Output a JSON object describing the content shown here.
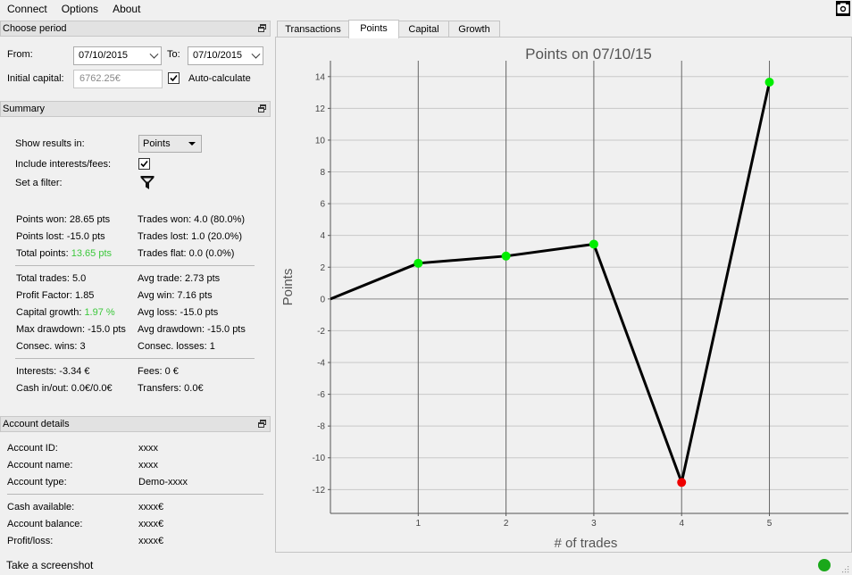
{
  "menu": [
    "Connect",
    "Options",
    "About"
  ],
  "icons": {
    "screenshot": "camera-icon",
    "float": "float-window-icon",
    "filter": "filter-funnel-icon",
    "status": "status-ok-dot"
  },
  "period": {
    "title": "Choose period",
    "from_label": "From:",
    "from_value": "07/10/2015",
    "to_label": "To:",
    "to_value": "07/10/2015",
    "capital_label": "Initial capital:",
    "capital_value": "6762.25€",
    "autocalc_label": "Auto-calculate",
    "autocalc_checked": true
  },
  "summary": {
    "title": "Summary",
    "show_label": "Show results in:",
    "show_value": "Points",
    "interests_label": "Include interests/fees:",
    "interests_checked": true,
    "filter_label": "Set a filter:",
    "stats": {
      "points_won": "Points won: 28.65 pts",
      "trades_won": "Trades won: 4.0 (80.0%)",
      "points_lost": "Points lost: -15.0 pts",
      "trades_lost": "Trades lost: 1.0 (20.0%)",
      "total_points_label": "Total points:",
      "total_points_value": "13.65 pts",
      "trades_flat": "Trades flat: 0.0 (0.0%)",
      "total_trades": "Total trades: 5.0",
      "avg_trade": "Avg trade: 2.73 pts",
      "profit_factor": "Profit Factor: 1.85",
      "avg_win": "Avg win: 7.16 pts",
      "capital_growth_label": "Capital growth:",
      "capital_growth_value": "1.97 %",
      "avg_loss": "Avg loss: -15.0 pts",
      "max_drawdown": "Max drawdown: -15.0 pts",
      "avg_drawdown": "Avg drawdown: -15.0 pts",
      "consec_wins": "Consec. wins: 3",
      "consec_losses": "Consec. losses: 1",
      "interests": "Interests: -3.34 €",
      "fees": "Fees: 0 €",
      "cash": "Cash in/out: 0.0€/0.0€",
      "transfers": "Transfers: 0.0€"
    }
  },
  "account": {
    "title": "Account details",
    "rows": [
      {
        "label": "Account ID:",
        "value": "xxxx"
      },
      {
        "label": "Account name:",
        "value": "xxxx"
      },
      {
        "label": "Account type:",
        "value": "Demo-xxxx"
      },
      {
        "label": "Cash available:",
        "value": "xxxx€"
      },
      {
        "label": "Account balance:",
        "value": "xxxx€"
      },
      {
        "label": "Profit/loss:",
        "value": "xxxx€"
      }
    ]
  },
  "tabs": [
    {
      "label": "Transactions",
      "active": false
    },
    {
      "label": "Points",
      "active": true
    },
    {
      "label": "Capital",
      "active": false
    },
    {
      "label": "Growth",
      "active": false
    }
  ],
  "chart_data": {
    "type": "line",
    "title": "Points on 07/10/15",
    "xlabel": "# of trades",
    "ylabel": "Points",
    "x": [
      0,
      1,
      2,
      3,
      4,
      5
    ],
    "y": [
      0,
      2.25,
      2.7,
      3.45,
      -11.55,
      13.65
    ],
    "point_colors": [
      null,
      "#00ee00",
      "#00ee00",
      "#00ee00",
      "#ee0000",
      "#00ee00"
    ],
    "xlim": [
      0,
      5.9
    ],
    "ylim": [
      -13.5,
      15
    ],
    "xticks": [
      1,
      2,
      3,
      4,
      5
    ],
    "yticks": [
      -12,
      -10,
      -8,
      -6,
      -4,
      -2,
      0,
      2,
      4,
      6,
      8,
      10,
      12,
      14
    ],
    "grid": true,
    "line_color": "#000000",
    "gain_color": "#00ee00",
    "loss_color": "#ee0000"
  },
  "status": {
    "text": "Take a screenshot"
  }
}
